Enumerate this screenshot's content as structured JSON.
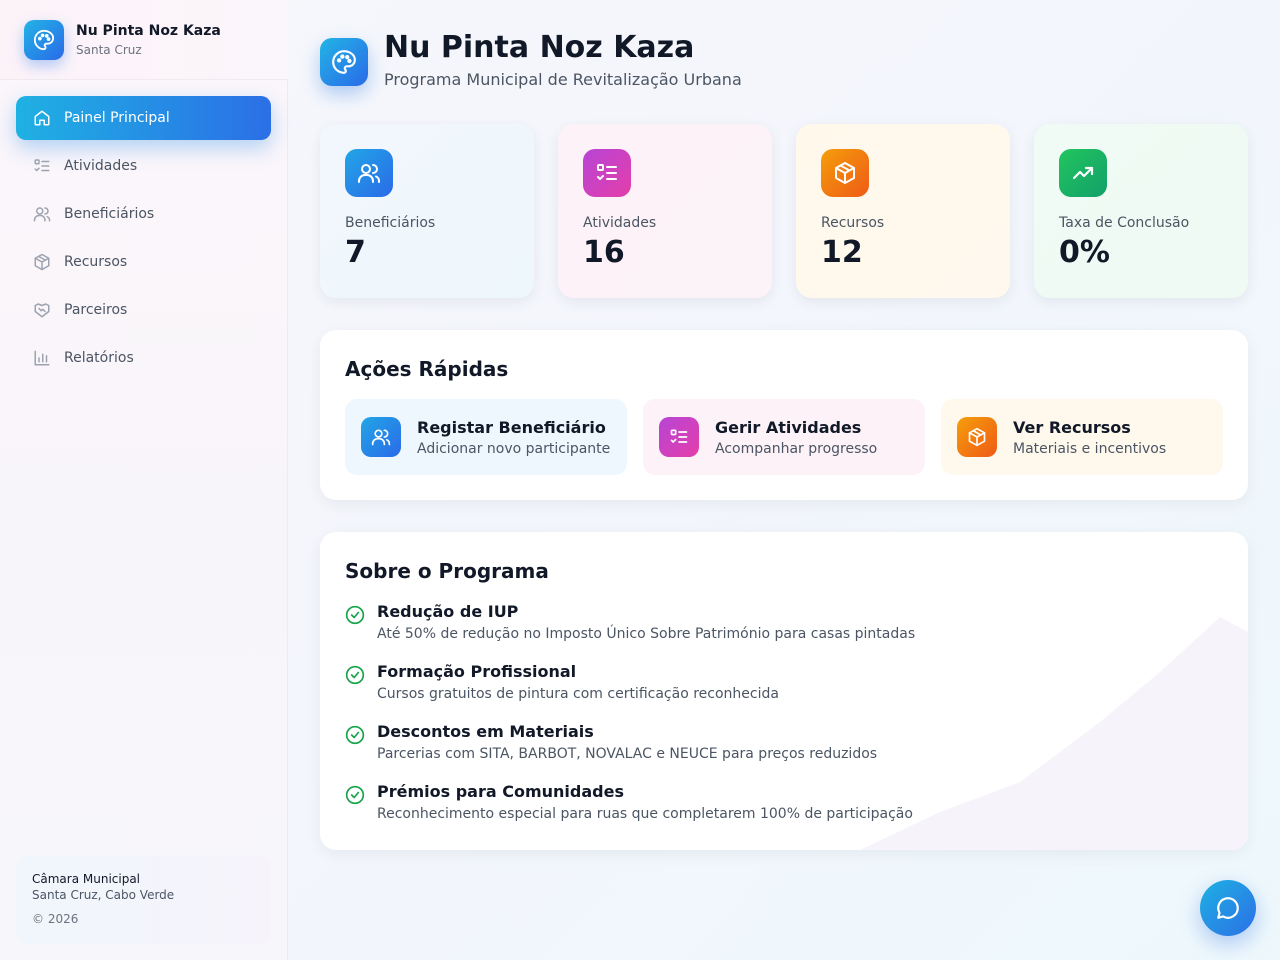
{
  "brand": {
    "title": "Nu Pinta Noz Kaza",
    "subtitle": "Santa Cruz",
    "icon": "palette-icon"
  },
  "nav": {
    "items": [
      {
        "label": "Painel Principal",
        "icon": "home-icon",
        "active": true
      },
      {
        "label": "Atividades",
        "icon": "checklist-icon"
      },
      {
        "label": "Beneficiários",
        "icon": "users-icon"
      },
      {
        "label": "Recursos",
        "icon": "package-icon"
      },
      {
        "label": "Parceiros",
        "icon": "handshake-icon"
      },
      {
        "label": "Relatórios",
        "icon": "bar-chart-icon"
      }
    ]
  },
  "footer": {
    "title": "Câmara Municipal",
    "location": "Santa Cruz, Cabo Verde",
    "copyright": "© 2026"
  },
  "header": {
    "title": "Nu Pinta Noz Kaza",
    "subtitle": "Programa Municipal de Revitalização Urbana"
  },
  "stats": [
    {
      "label": "Beneficiários",
      "value": "7",
      "icon": "users-icon",
      "color": "#2a8ae8"
    },
    {
      "label": "Atividades",
      "value": "16",
      "icon": "checklist-icon",
      "color": "#d03fc0"
    },
    {
      "label": "Recursos",
      "value": "12",
      "icon": "package-icon",
      "color": "#f07a10"
    },
    {
      "label": "Taxa de Conclusão",
      "value": "0%",
      "icon": "trending-up-icon",
      "color": "#1fa865"
    }
  ],
  "quick_actions": {
    "title": "Ações Rápidas",
    "items": [
      {
        "title": "Registar Beneficiário",
        "subtitle": "Adicionar novo participante",
        "icon": "users-icon"
      },
      {
        "title": "Gerir Atividades",
        "subtitle": "Acompanhar progresso",
        "icon": "checklist-icon"
      },
      {
        "title": "Ver Recursos",
        "subtitle": "Materiais e incentivos",
        "icon": "package-icon"
      }
    ]
  },
  "about": {
    "title": "Sobre o Programa",
    "features": [
      {
        "title": "Redução de IUP",
        "description": "Até 50% de redução no Imposto Único Sobre Património para casas pintadas"
      },
      {
        "title": "Formação Profissional",
        "description": "Cursos gratuitos de pintura com certificação reconhecida"
      },
      {
        "title": "Descontos em Materiais",
        "description": "Parcerias com SITA, BARBOT, NOVALAC e NEUCE para preços reduzidos"
      },
      {
        "title": "Prémios para Comunidades",
        "description": "Reconhecimento especial para ruas que completarem 100% de participação"
      }
    ]
  },
  "chat": {
    "icon": "chat-icon"
  }
}
